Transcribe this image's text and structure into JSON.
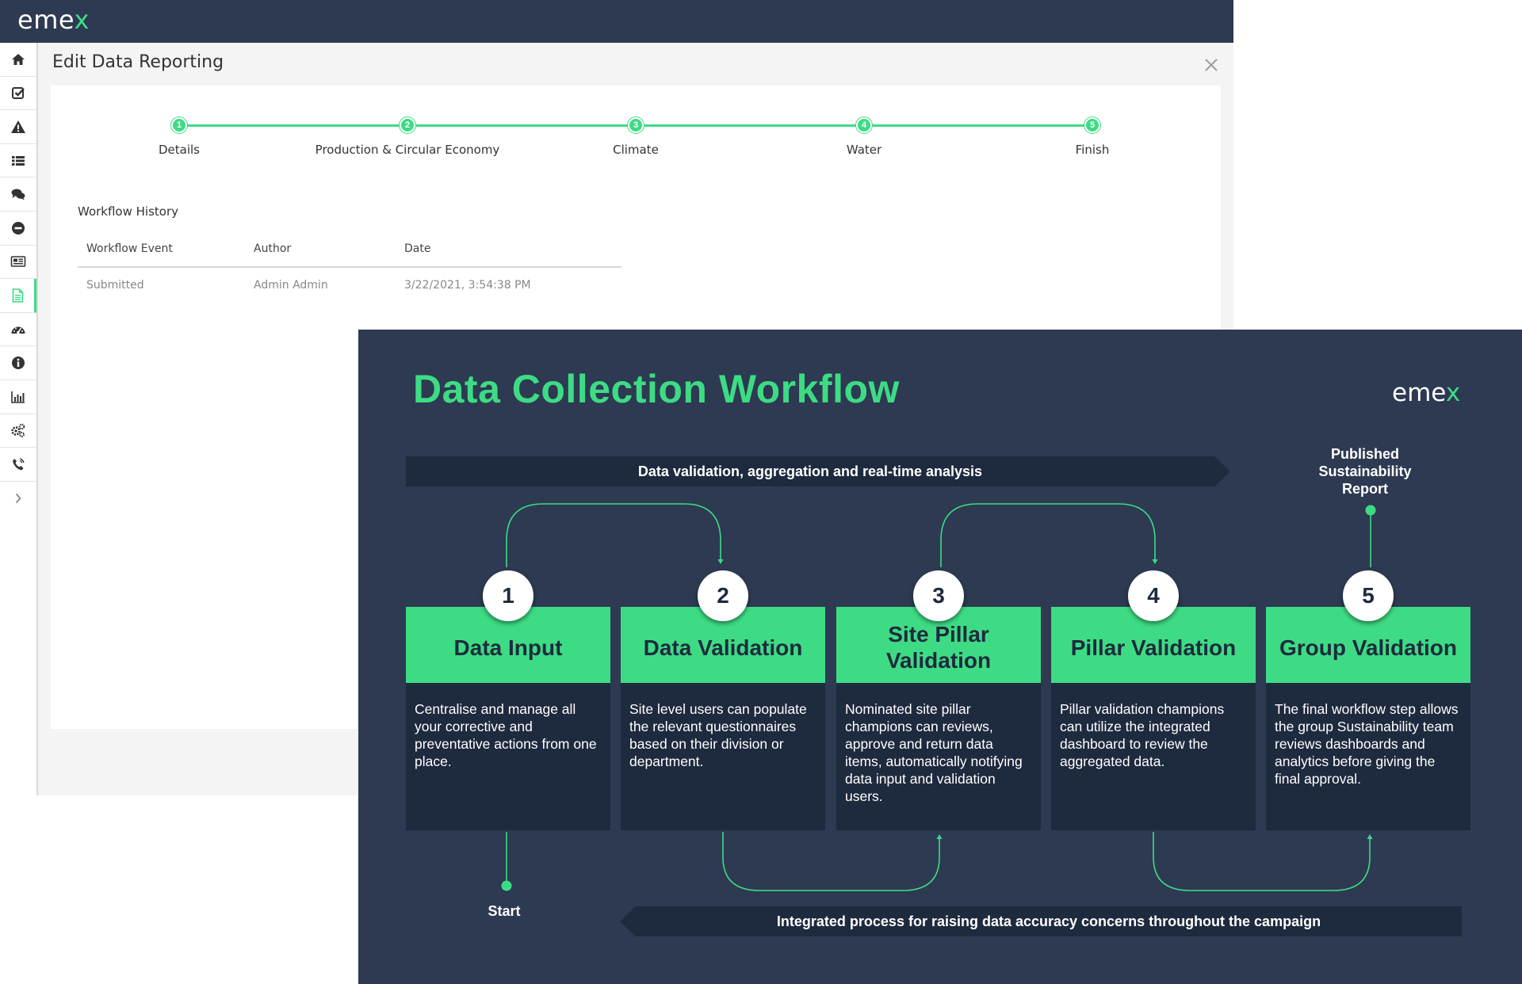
{
  "app": {
    "logo_text": "eme",
    "logo_accent": "x",
    "dialog_title": "Edit Data Reporting",
    "sidebar": [
      {
        "icon": "home-icon"
      },
      {
        "icon": "checkbox-icon"
      },
      {
        "icon": "warning-icon"
      },
      {
        "icon": "list-icon"
      },
      {
        "icon": "comments-icon"
      },
      {
        "icon": "minus-circle-icon"
      },
      {
        "icon": "newspaper-icon"
      },
      {
        "icon": "document-icon",
        "active": true
      },
      {
        "icon": "dashboard-icon"
      },
      {
        "icon": "info-icon"
      },
      {
        "icon": "bar-chart-icon"
      },
      {
        "icon": "cogs-icon"
      },
      {
        "icon": "phone-icon"
      },
      {
        "icon": "chevron-right-icon"
      }
    ],
    "steps": [
      {
        "number": "1",
        "label": "Details"
      },
      {
        "number": "2",
        "label": "Production & Circular Economy"
      },
      {
        "number": "3",
        "label": "Climate"
      },
      {
        "number": "4",
        "label": "Water"
      },
      {
        "number": "5",
        "label": "Finish"
      }
    ],
    "workflow_history": {
      "title": "Workflow History",
      "columns": [
        "Workflow Event",
        "Author",
        "Date"
      ],
      "rows": [
        {
          "event": "Submitted",
          "author": "Admin Admin",
          "date": "3/22/2021, 3:54:38 PM"
        }
      ]
    }
  },
  "infographic": {
    "title": "Data Collection Workflow",
    "logo_text": "eme",
    "logo_accent": "x",
    "top_banner": "Data validation, aggregation and real-time analysis",
    "bottom_banner": "Integrated process for raising data accuracy concerns throughout the campaign",
    "published_lines": [
      "Published",
      "Sustainability",
      "Report"
    ],
    "start_label": "Start",
    "stages": [
      {
        "number": "1",
        "title": "Data Input",
        "body": "Centralise and manage all your corrective and preventative actions from one place."
      },
      {
        "number": "2",
        "title": "Data Validation",
        "body": "Site level users can populate the relevant questionnaires based on their division or department."
      },
      {
        "number": "3",
        "title": "Site Pillar Validation",
        "body": "Nominated site pillar champions can reviews, approve and return data items, automatically notifying data input and validation users."
      },
      {
        "number": "4",
        "title": "Pillar Validation",
        "body": "Pillar validation champions can utilize the integrated dashboard to review the aggregated data."
      },
      {
        "number": "5",
        "title": "Group Validation",
        "body": "The final workflow step allows the group Sustainability team reviews dashboards and analytics before giving the final approval."
      }
    ]
  },
  "colors": {
    "header_bg": "#2d3a52",
    "accent_green": "#3ddc84",
    "panel_dark": "#1e2a3e",
    "infographic_bg": "#2d3a52"
  }
}
